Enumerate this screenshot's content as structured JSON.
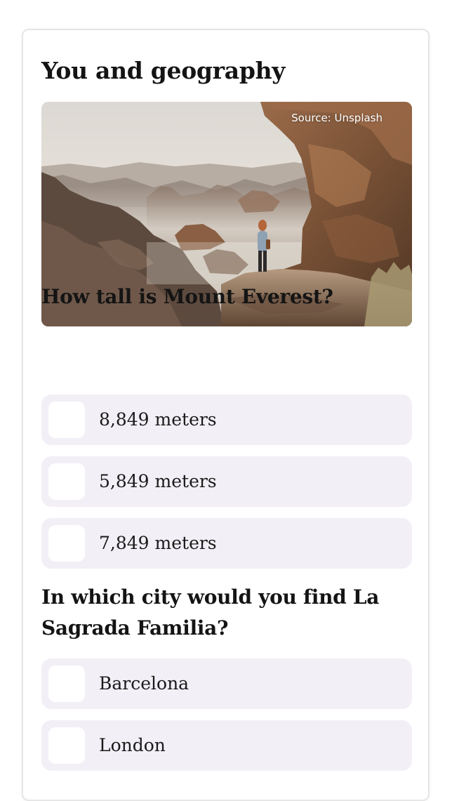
{
  "quiz": {
    "title": "You and geography"
  },
  "hero_image": {
    "caption": "Source: Unsplash",
    "description": "person standing on a rock ledge overlooking a misty canyon"
  },
  "questions": [
    {
      "text": "How tall is Mount Everest?",
      "options": [
        {
          "label": "8,849 meters",
          "checked": false
        },
        {
          "label": "5,849 meters",
          "checked": false
        },
        {
          "label": "7,849 meters",
          "checked": false
        }
      ]
    },
    {
      "text": "In which city would you find La Sagrada Familia?",
      "options": [
        {
          "label": "Barcelona",
          "checked": false
        },
        {
          "label": "London",
          "checked": false
        }
      ]
    }
  ],
  "colors": {
    "option_background": "#f3eff6",
    "checkbox_background": "#ffffff",
    "text": "#141414"
  }
}
